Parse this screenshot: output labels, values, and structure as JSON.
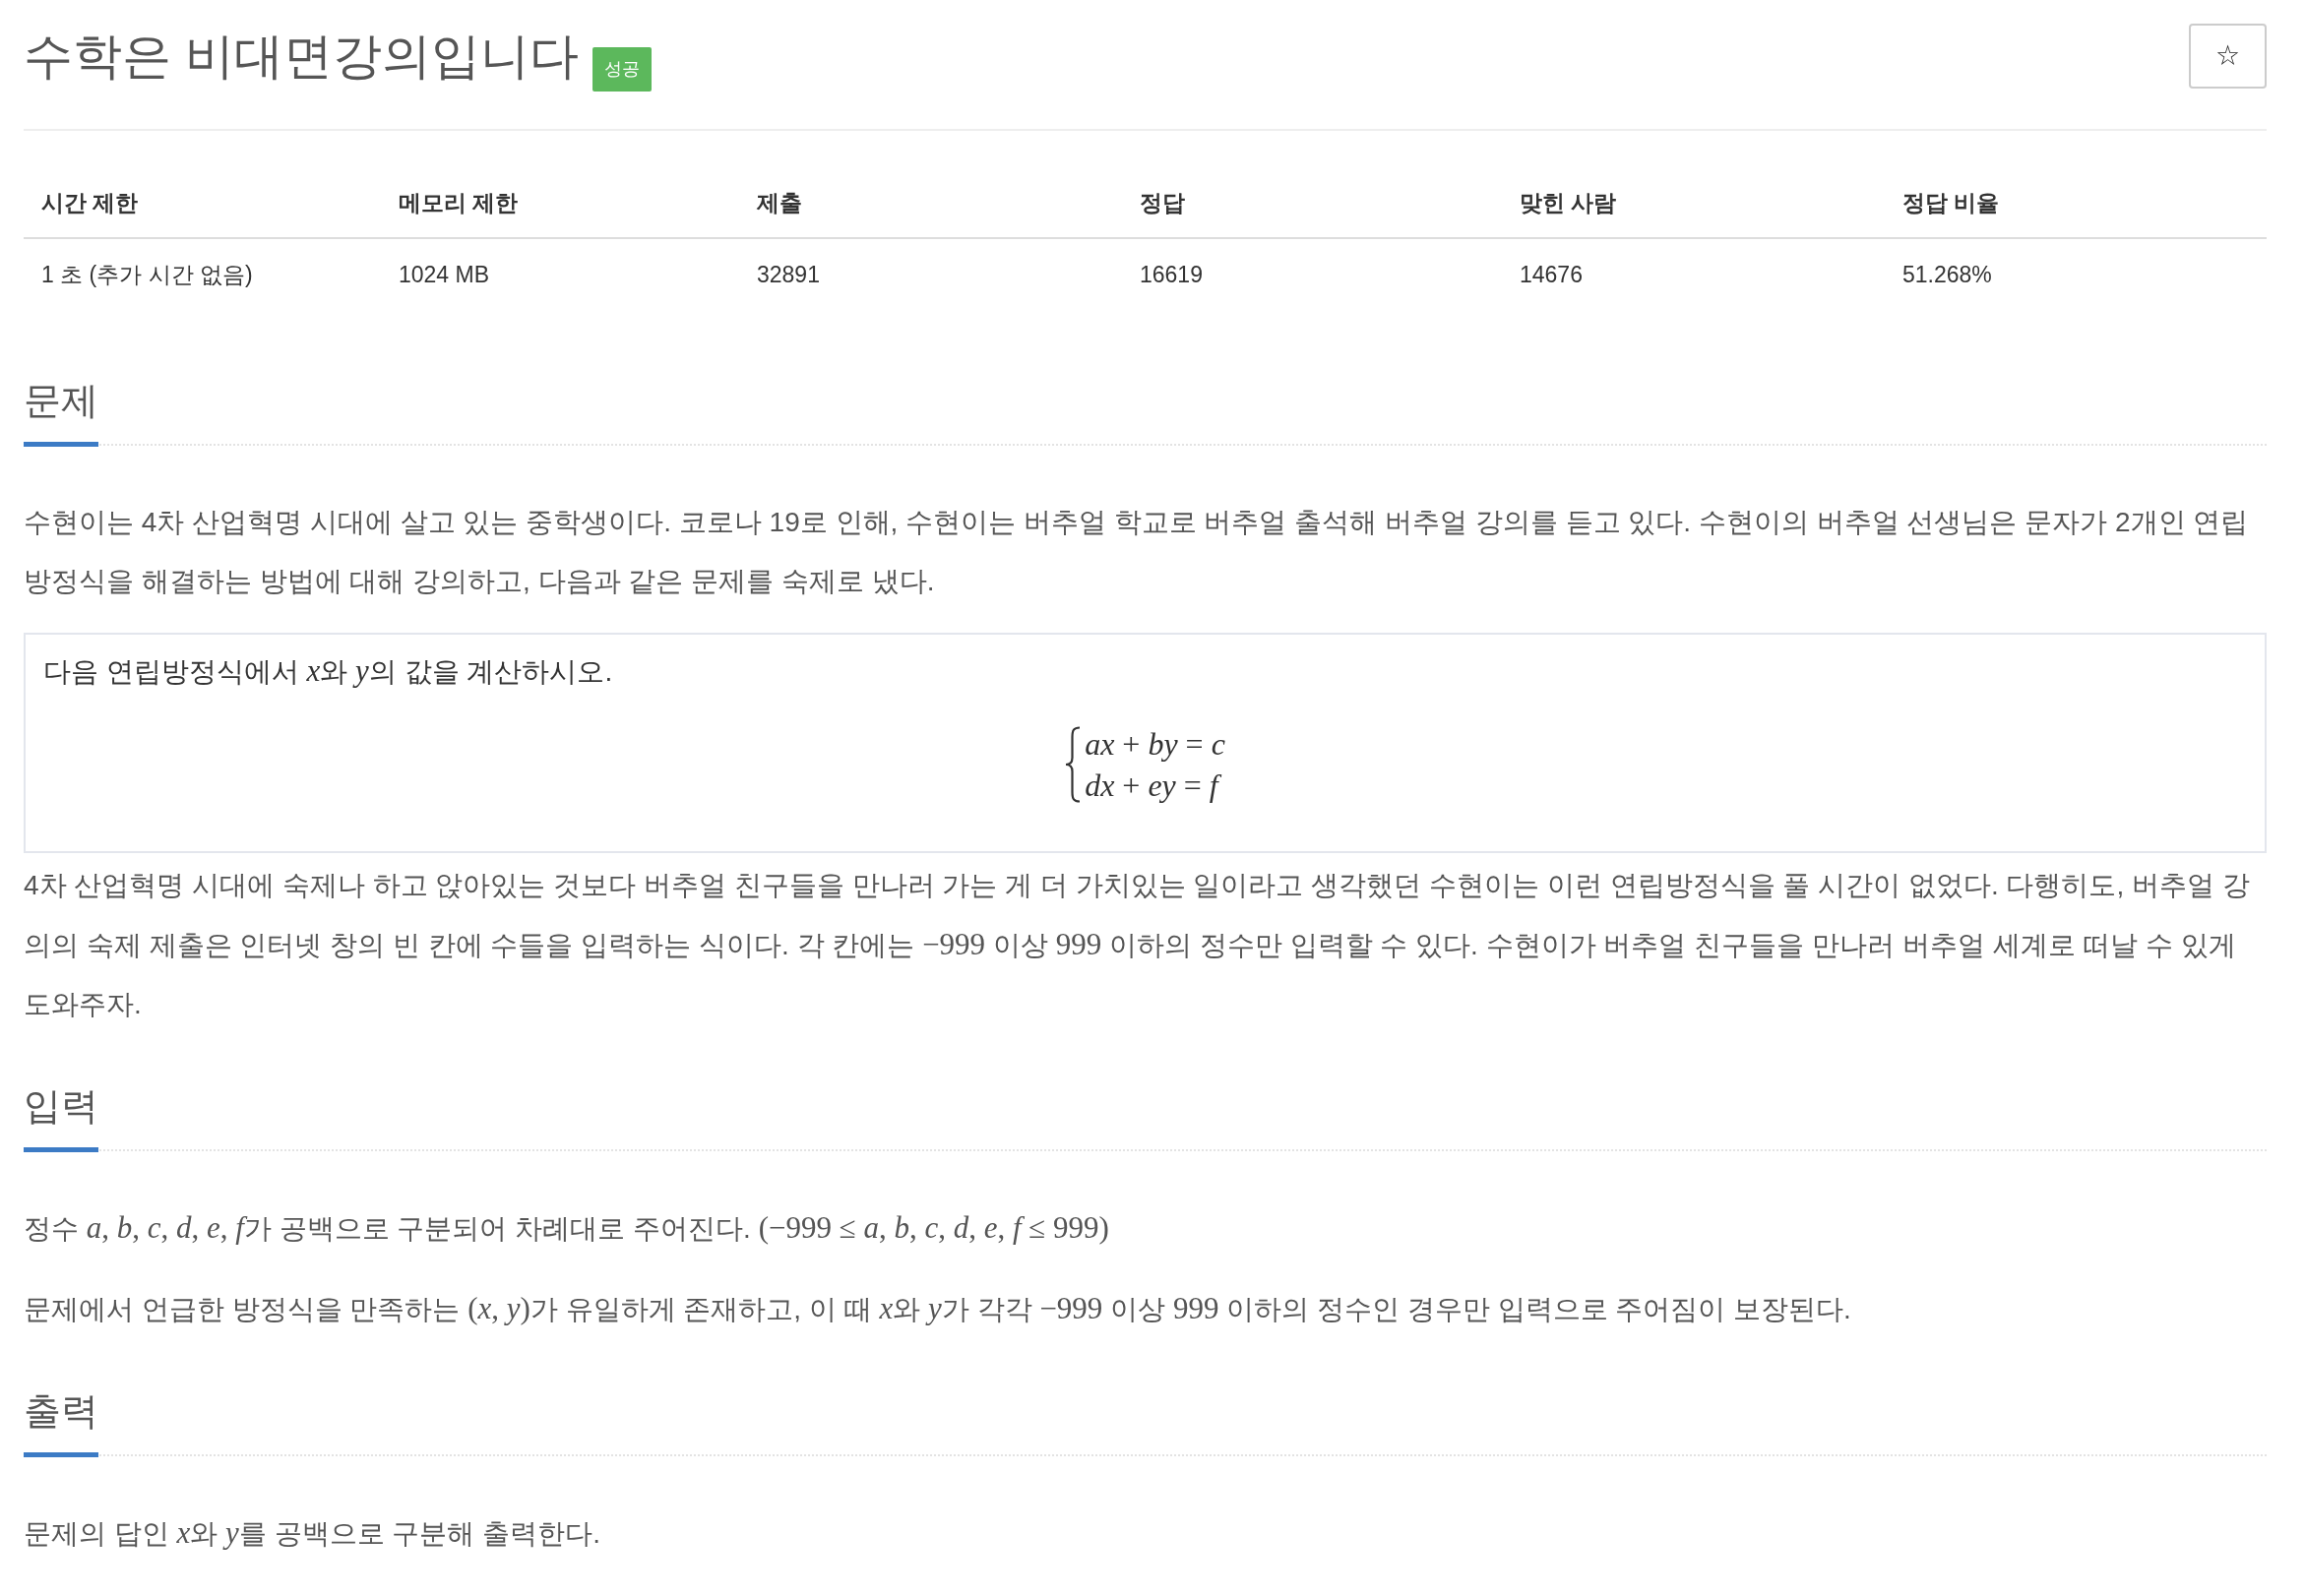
{
  "title": {
    "text": "수학은 비대면강의입니다",
    "badge": "성공"
  },
  "star_button": {
    "label": "☆"
  },
  "info_table": {
    "columns": [
      "시간 제한",
      "메모리 제한",
      "제출",
      "정답",
      "맞힌 사람",
      "정답 비율"
    ],
    "rows": [
      [
        "1 초 (추가 시간 없음)",
        "1024 MB",
        "32891",
        "16619",
        "14676",
        "51.268%"
      ]
    ]
  },
  "sections": [
    {
      "heading": "문제",
      "blocks": [
        {
          "kind": "paragraph",
          "runs": [
            {
              "kind": "text",
              "text": "수현이는 4차 산업혁명 시대에 살고 있는 중학생이다. 코로나 19로 인해, 수현이는 버추얼 학교로 버추얼 출석해 버추얼 강의를 듣고 있다. 수현이의 버추얼 선생님은 문자가 2개인 연립방정식을 해결하는 방법에 대해 강의하고, 다음과 같은 문제를 숙제로 냈다."
            }
          ]
        },
        {
          "kind": "box",
          "runs": [
            {
              "kind": "text",
              "text": "다음 연립방정식에서 "
            },
            {
              "kind": "math",
              "text": "*x*"
            },
            {
              "kind": "text",
              "text": "와 "
            },
            {
              "kind": "math",
              "text": "*y*"
            },
            {
              "kind": "text",
              "text": "의 값을 계산하시오."
            }
          ],
          "equations": [
            "*ax* + *by* = *c*",
            "*dx* + *ey* = *f*"
          ]
        },
        {
          "kind": "paragraph",
          "runs": [
            {
              "kind": "text",
              "text": "4차 산업혁명 시대에 숙제나 하고 앉아있는 것보다 버추얼 친구들을 만나러 가는 게 더 가치있는 일이라고 생각했던 수현이는 이런 연립방정식을 풀 시간이 없었다. 다행히도, 버추얼 강의의 숙제 제출은 인터넷 창의 빈 칸에 수들을 입력하는 식이다. 각 칸에는 "
            },
            {
              "kind": "math",
              "text": "−999"
            },
            {
              "kind": "text",
              "text": " 이상 "
            },
            {
              "kind": "math",
              "text": "999"
            },
            {
              "kind": "text",
              "text": " 이하의 정수만 입력할 수 있다. 수현이가 버추얼 친구들을 만나러 버추얼 세계로 떠날 수 있게 도와주자."
            }
          ]
        }
      ]
    },
    {
      "heading": "입력",
      "blocks": [
        {
          "kind": "paragraph",
          "runs": [
            {
              "kind": "text",
              "text": "정수 "
            },
            {
              "kind": "math",
              "text": "*a*, *b*, *c*, *d*, *e*, *f*"
            },
            {
              "kind": "text",
              "text": "가 공백으로 구분되어 차례대로 주어진다. "
            },
            {
              "kind": "math",
              "text": "(−999 ≤ *a*, *b*, *c*, *d*, *e*, *f* ≤ 999)"
            }
          ]
        },
        {
          "kind": "paragraph",
          "runs": [
            {
              "kind": "text",
              "text": "문제에서 언급한 방정식을 만족하는 "
            },
            {
              "kind": "math",
              "text": "(*x*, *y*)"
            },
            {
              "kind": "text",
              "text": "가 유일하게 존재하고, 이 때 "
            },
            {
              "kind": "math",
              "text": "*x*"
            },
            {
              "kind": "text",
              "text": "와 "
            },
            {
              "kind": "math",
              "text": "*y*"
            },
            {
              "kind": "text",
              "text": "가 각각 "
            },
            {
              "kind": "math",
              "text": "−999"
            },
            {
              "kind": "text",
              "text": " 이상 "
            },
            {
              "kind": "math",
              "text": "999"
            },
            {
              "kind": "text",
              "text": " 이하의 정수인 경우만 입력으로 주어짐이 보장된다."
            }
          ]
        }
      ]
    },
    {
      "heading": "출력",
      "blocks": [
        {
          "kind": "paragraph",
          "runs": [
            {
              "kind": "text",
              "text": "문제의 답인 "
            },
            {
              "kind": "math",
              "text": "*x*"
            },
            {
              "kind": "text",
              "text": "와 "
            },
            {
              "kind": "math",
              "text": "*y*"
            },
            {
              "kind": "text",
              "text": "를 공백으로 구분해 출력한다."
            }
          ]
        }
      ]
    }
  ]
}
